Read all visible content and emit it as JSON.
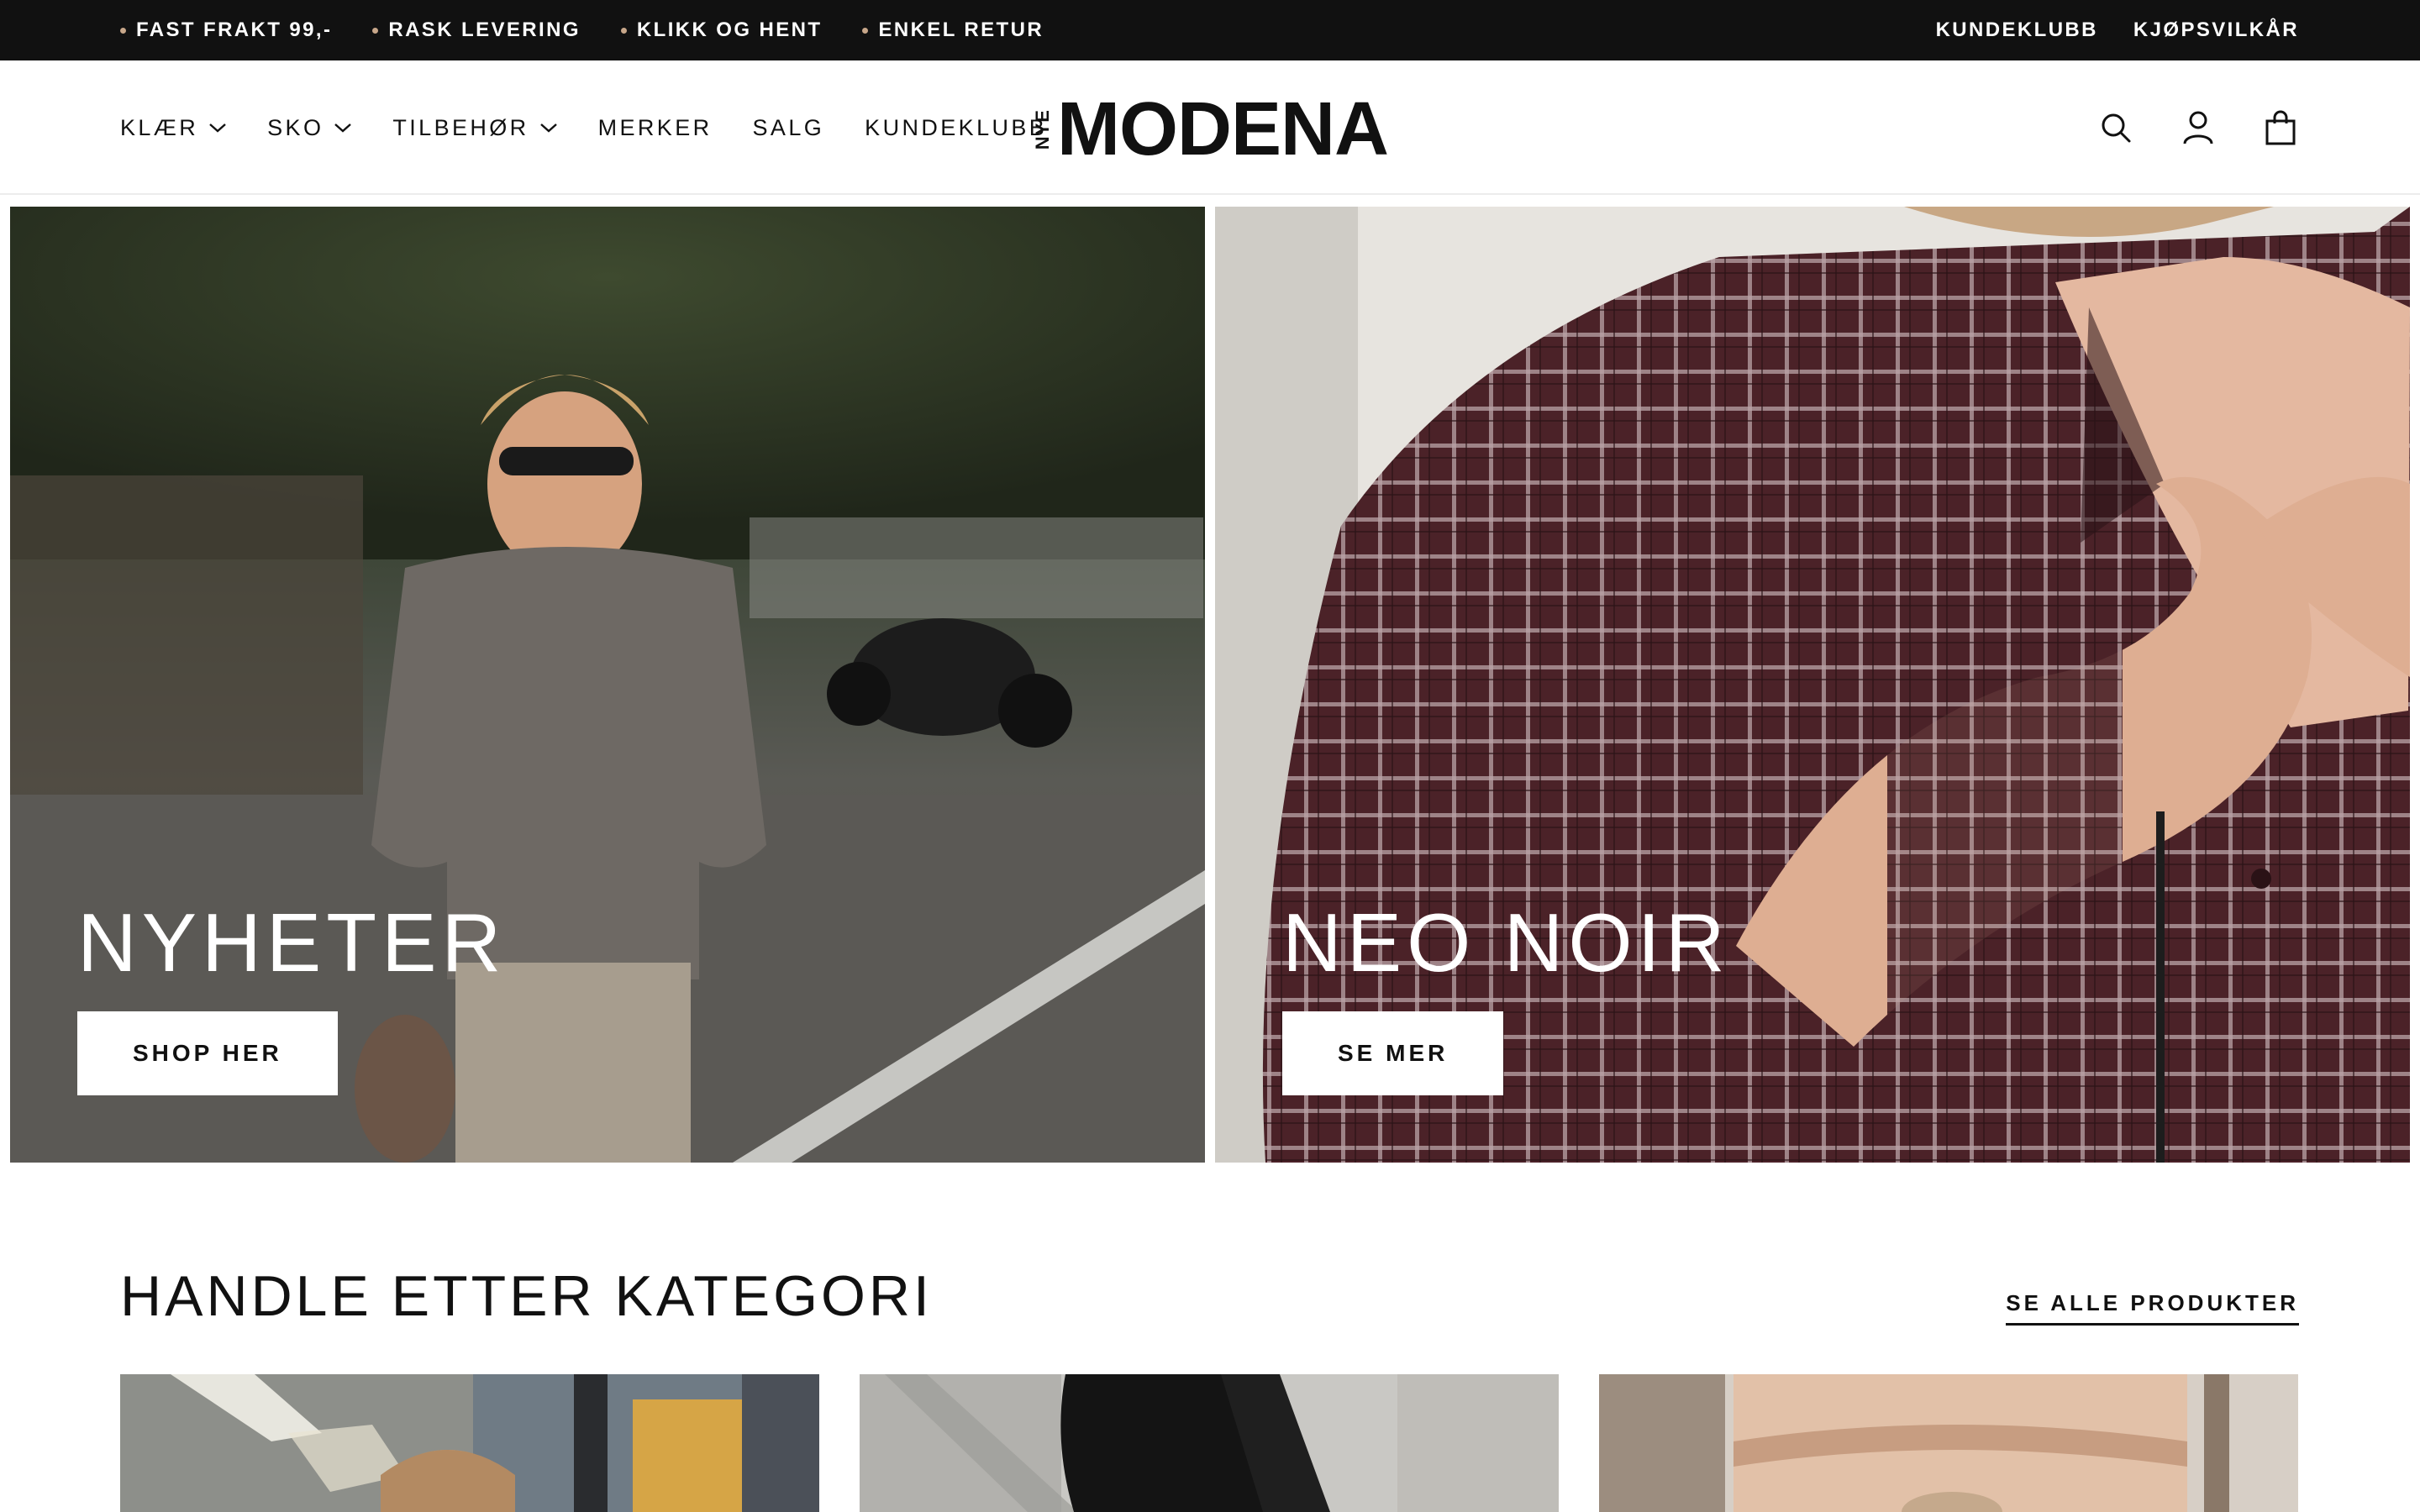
{
  "announcement": {
    "usps": [
      "FAST FRAKT 99,-",
      "RASK LEVERING",
      "KLIKK OG HENT",
      "ENKEL RETUR"
    ],
    "links": [
      "KUNDEKLUBB",
      "KJØPSVILKÅR"
    ]
  },
  "header": {
    "nav": [
      {
        "label": "KLÆR",
        "has_dropdown": true
      },
      {
        "label": "SKO",
        "has_dropdown": true
      },
      {
        "label": "TILBEHØR",
        "has_dropdown": true
      },
      {
        "label": "MERKER",
        "has_dropdown": false
      },
      {
        "label": "SALG",
        "has_dropdown": false
      },
      {
        "label": "KUNDEKLUBB",
        "has_dropdown": false
      }
    ],
    "logo": {
      "prefix": "NYE",
      "name": "MODENA"
    },
    "icons": [
      "search-icon",
      "account-icon",
      "cart-icon"
    ]
  },
  "hero": [
    {
      "title": "NYHETER",
      "cta": "SHOP HER"
    },
    {
      "title": "NEO NOIR",
      "cta": "SE MER"
    }
  ],
  "categories": {
    "title": "HANDLE ETTER KATEGORI",
    "see_all": "SE ALLE PRODUKTER"
  },
  "colors": {
    "announcement_bg": "#111111",
    "usp_dot": "#c8a78a",
    "text": "#111111"
  }
}
